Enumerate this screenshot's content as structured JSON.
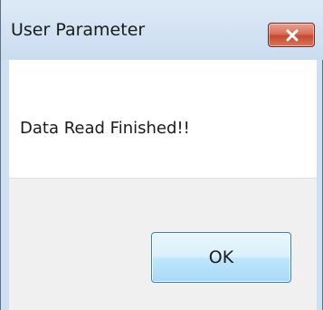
{
  "dialog": {
    "title": "User Parameter",
    "close_icon": "close-x-icon",
    "message": "Data Read Finished!!",
    "ok_label": "OK"
  },
  "colors": {
    "titlebar": "#cfe0f3",
    "close_button": "#c44a30",
    "ok_button": "#bee6fd",
    "footer": "#f0f0f0"
  }
}
